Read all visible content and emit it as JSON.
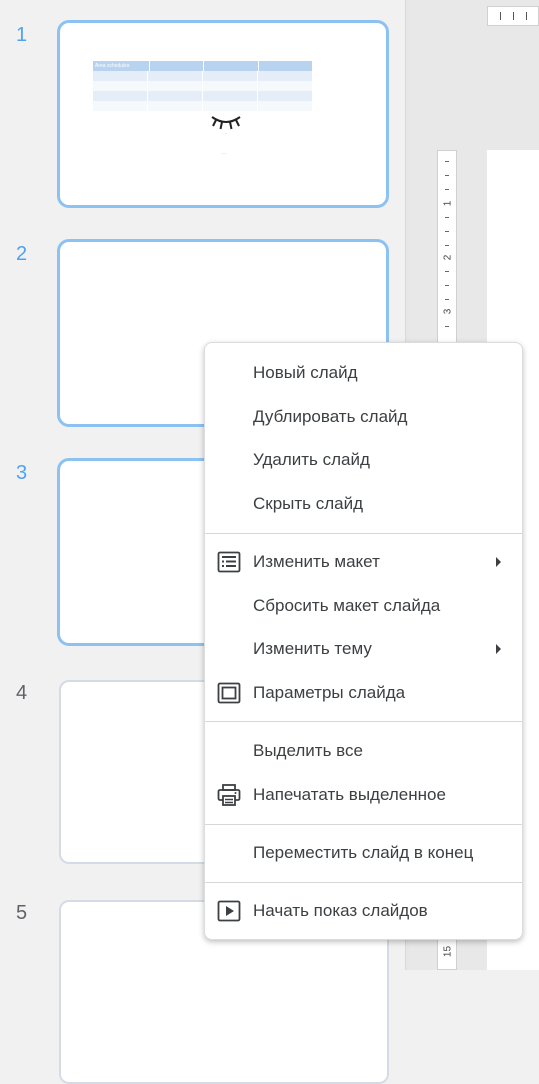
{
  "filmstrip": {
    "slides": [
      {
        "number": "1"
      },
      {
        "number": "2"
      },
      {
        "number": "3"
      },
      {
        "number": "4"
      },
      {
        "number": "5"
      }
    ],
    "thumb1_table_header": "Area   schedules"
  },
  "rulers": {
    "side_numbers": [
      "1",
      "2",
      "3",
      "15"
    ]
  },
  "context_menu": {
    "new_slide": "Новый слайд",
    "duplicate_slide": "Дублировать слайд",
    "delete_slide": "Удалить слайд",
    "hide_slide": "Скрыть слайд",
    "change_layout": "Изменить макет",
    "reset_layout": "Сбросить макет слайда",
    "change_theme": "Изменить тему",
    "slide_settings": "Параметры слайда",
    "select_all": "Выделить все",
    "print_selected": "Напечатать выделенное",
    "move_to_end": "Переместить слайд в конец",
    "start_slideshow": "Начать показ слайдов"
  },
  "colors": {
    "selected_border": "#8cc2f2",
    "selected_number": "#4ea3f0",
    "menu_text": "#3c4043"
  },
  "icons": [
    "layout-icon",
    "slide-settings-icon",
    "printer-icon",
    "play-icon",
    "chevron-right-icon",
    "closed-eye-icon"
  ]
}
